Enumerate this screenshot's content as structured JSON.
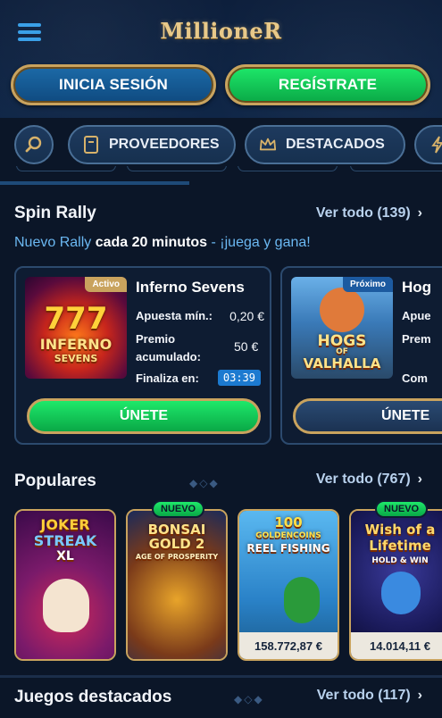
{
  "header": {
    "logo": "MillioneR",
    "login_label": "INICIA SESIÓN",
    "register_label": "REGÍSTRATE"
  },
  "filters": {
    "providers_label": "PROVEEDORES",
    "featured_label": "DESTACADOS"
  },
  "spin_rally": {
    "title": "Spin Rally",
    "see_all": "Ver todo (139)",
    "tagline_prefix": "Nuevo Rally ",
    "tagline_bold": "cada 20 minutos",
    "tagline_suffix": " - ¡juega y gana!",
    "cards": [
      {
        "status": "Activo",
        "name": "Inferno Sevens",
        "art_line1": "777",
        "art_line2": "INFERNO",
        "art_line3": "SEVENS",
        "min_bet_label": "Apuesta mín.:",
        "min_bet_value": "0,20 €",
        "prize_label": "Premio acumulado:",
        "prize_value": "50 €",
        "ends_label": "Finaliza en:",
        "ends_value": "03:39",
        "join_label": "ÚNETE"
      },
      {
        "status": "Próximo",
        "name": "Hog",
        "art_line1": "HOGS",
        "art_line2": "OF",
        "art_line3": "VALHALLA",
        "min_bet_label": "Apue",
        "prize_label": "Prem",
        "ends_label": "Com",
        "join_label": "ÚNETE"
      }
    ]
  },
  "populares": {
    "title": "Populares",
    "see_all": "Ver todo (767)",
    "games": [
      {
        "line1": "JOKER",
        "line2": "STREAK",
        "line3": "XL"
      },
      {
        "badge": "NUEVO",
        "line1": "BONSAI",
        "line2": "GOLD 2",
        "line3": "AGE OF PROSPERITY"
      },
      {
        "line1": "100",
        "line2": "GOLDENCOINS",
        "line3": "REEL FISHING",
        "jackpot": "158.772,87 €"
      },
      {
        "badge": "NUEVO",
        "line1": "Wish of a",
        "line2": "Lifetime",
        "line3": "HOLD & WIN",
        "jackpot": "14.014,11 €"
      }
    ]
  },
  "destacados": {
    "title": "Juegos destacados",
    "see_all": "Ver todo (117)"
  },
  "colors": {
    "background": "#0b1628",
    "accent_green": "#1ee86a",
    "accent_blue": "#1c6aa8",
    "gold": "#c9a35e"
  }
}
